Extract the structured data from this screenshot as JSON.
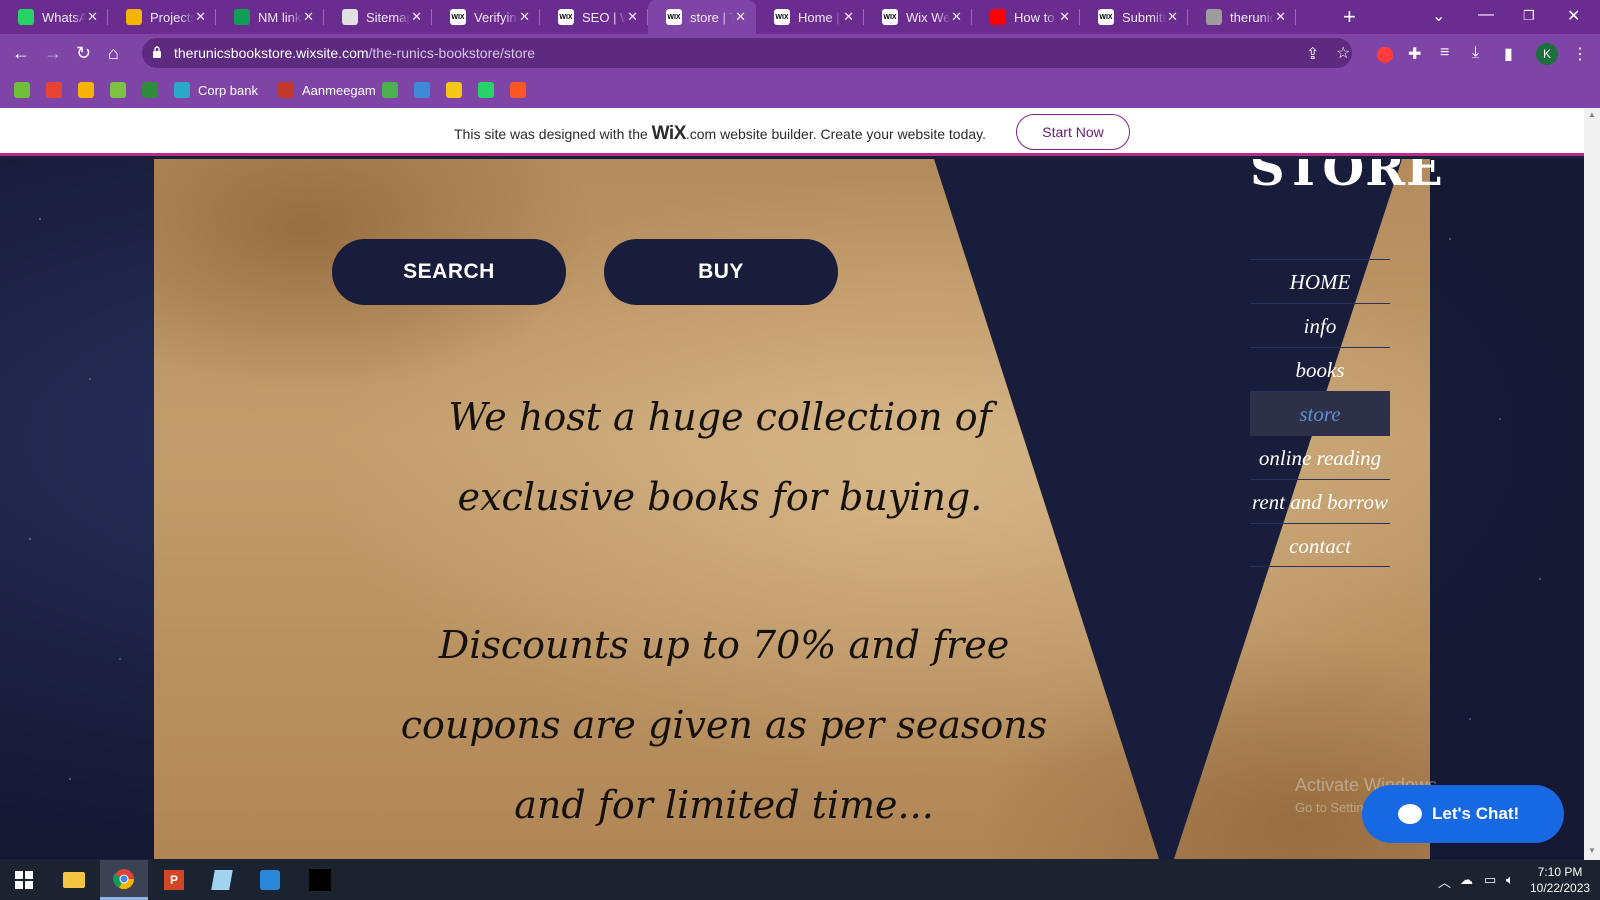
{
  "browser": {
    "tabs": [
      {
        "title": "WhatsApp",
        "favicon": "whatsapp-icon",
        "color": "#25d366"
      },
      {
        "title": "Projects",
        "favicon": "google-drive-icon",
        "color": "#f4b400"
      },
      {
        "title": "NM link",
        "favicon": "google-sheets-icon",
        "color": "#0f9d58"
      },
      {
        "title": "Sitemap",
        "favicon": "sitemap-icon",
        "color": "#e0e0e0"
      },
      {
        "title": "Verifying",
        "favicon": "wix-icon",
        "color": "#ffffff"
      },
      {
        "title": "SEO | W",
        "favicon": "wix-icon",
        "color": "#ffffff"
      },
      {
        "title": "store | T",
        "favicon": "wix-icon",
        "color": "#ffffff",
        "active": true
      },
      {
        "title": "Home |",
        "favicon": "wix-icon",
        "color": "#ffffff"
      },
      {
        "title": "Wix We",
        "favicon": "wix-icon",
        "color": "#ffffff"
      },
      {
        "title": "How to",
        "favicon": "youtube-icon",
        "color": "#ff0000"
      },
      {
        "title": "Submitt",
        "favicon": "wix-icon",
        "color": "#ffffff"
      },
      {
        "title": "therunic",
        "favicon": "globe-icon",
        "color": "#9c9c9c"
      }
    ],
    "url_host": "therunicsbookstore.wixsite.com",
    "url_path": "/the-runics-bookstore/store",
    "profile_initial": "K",
    "bookmarks": [
      {
        "label": "",
        "icon": "leaf-icon",
        "color": "#6fbf3a"
      },
      {
        "label": "",
        "icon": "gmail-icon",
        "color": "#ea4335"
      },
      {
        "label": "",
        "icon": "crown-icon",
        "color": "#f6b400"
      },
      {
        "label": "",
        "icon": "notes-icon",
        "color": "#7dc243"
      },
      {
        "label": "",
        "icon": "tree-icon",
        "color": "#2e8b3a"
      },
      {
        "label": "Corp bank",
        "icon": "bank-icon",
        "color": "#2aa7c9"
      },
      {
        "label": "Aanmeegam",
        "icon": "temple-icon",
        "color": "#c0392b"
      },
      {
        "label": "",
        "icon": "moon-icon",
        "color": "#4caf50"
      },
      {
        "label": "",
        "icon": "sparkle-icon",
        "color": "#3f8ad8"
      },
      {
        "label": "",
        "icon": "image-icon",
        "color": "#f5c518"
      },
      {
        "label": "",
        "icon": "whatsapp-icon",
        "color": "#25d366"
      },
      {
        "label": "",
        "icon": "k-icon",
        "color": "#ff5722"
      }
    ]
  },
  "wix_banner": {
    "text_before": "This site was designed with the ",
    "brand": "WiX",
    "text_after": ".com website builder. Create your website today.",
    "cta": "Start Now"
  },
  "site": {
    "store_title": "STORE",
    "buttons": {
      "search": "SEARCH",
      "buy": "BUY"
    },
    "tagline1": "We host a huge collection of exclusive books for buying.",
    "tagline2": "Discounts up to 70% and free coupons are given as per seasons and for limited time...",
    "menu": [
      {
        "label": "HOME"
      },
      {
        "label": "info"
      },
      {
        "label": "books"
      },
      {
        "label": "store",
        "active": true
      },
      {
        "label": "online reading"
      },
      {
        "label": "rent and borrow"
      },
      {
        "label": "contact"
      }
    ],
    "chat_label": "Let's Chat!",
    "watermark_title": "Activate Windows",
    "watermark_sub": "Go to Settings to activate Windows.",
    "colors": {
      "navy": "#171d3a",
      "parchment": "#c29d6c",
      "active_menu": "#5f8fd6"
    }
  },
  "taskbar": {
    "apps": [
      "windows-start-icon",
      "file-explorer-icon",
      "chrome-icon",
      "powerpoint-icon",
      "notepad-icon",
      "photos-icon",
      "terminal-icon"
    ],
    "time": "7:10 PM",
    "date": "10/22/2023"
  }
}
